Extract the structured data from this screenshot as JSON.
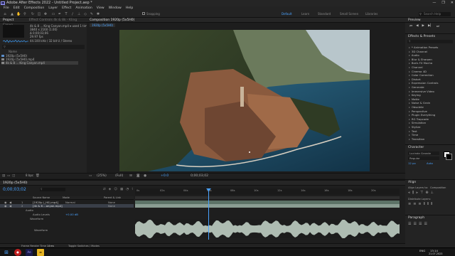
{
  "window": {
    "title": "Adobe After Effects 2022 - Untitled Project.aep *",
    "controls": [
      "—",
      "❐",
      "✕"
    ]
  },
  "menu": [
    "File",
    "Edit",
    "Composition",
    "Layer",
    "Effect",
    "Animation",
    "View",
    "Window",
    "Help"
  ],
  "toolbar": {
    "snapping": "Snapping",
    "workspaces": [
      "Default",
      "Learn",
      "Standard",
      "Small Screen",
      "Libraries"
    ],
    "active_workspace": "Default",
    "search_placeholder": "Search Help"
  },
  "project": {
    "tab": "Project",
    "effect_controls_tab": "Effect Controls 4k & 8k - Kling Canyo",
    "selected_name": "4k & 8 ... King Canyon.mp4 ▾ used 1 time",
    "selected_dims": "3840 x 2160 (1.00)",
    "selected_duration": "Δ 0;00;03;06",
    "selected_fps": "29.97 fps",
    "audio_info": "44.100 kHz / 32 bit U / Stereo",
    "col_name": "Name",
    "items": [
      "1920p (5x5H0)",
      "1920p (5x5H0).mp4",
      "4k & 8 ... King Canyon.mp4"
    ],
    "bpc": "8 bpc"
  },
  "composition": {
    "tab": "Composition  1920p (5x5H0)",
    "sub_tab": "1920p (5x5H0)",
    "zoom": "(25%)",
    "quality": "(Full)",
    "timecode": "0;00;03;02",
    "exposure": "+0.0"
  },
  "preview": {
    "title": "Preview"
  },
  "effects": {
    "title": "Effects & Presets",
    "search_placeholder": "",
    "items": [
      "* Animation Presets",
      "3D Channel",
      "Audio",
      "Blur & Sharpen",
      "Boris FX Mocha",
      "Channel",
      "Cinema 4D",
      "Color Correction",
      "Distort",
      "Expression Controls",
      "Generate",
      "Immersive Video",
      "Keying",
      "Matte",
      "Noise & Grain",
      "Obsolete",
      "Perspective",
      "Plugin Everything",
      "RG Trapcode",
      "Simulation",
      "Stylize",
      "Text",
      "Time",
      "Transition"
    ]
  },
  "character": {
    "title": "Character",
    "font": "Lucinda Grande",
    "style": "Regular",
    "size": "12 px",
    "leading": "Auto",
    "tracking": "0"
  },
  "align": {
    "title": "Align",
    "align_to": "Align Layers to:",
    "align_target": "Composition",
    "distribute": "Distribute Layers:"
  },
  "paragraph": {
    "title": "Paragraph"
  },
  "timeline": {
    "tab": "1920p (5x5H0)",
    "render_queue": "Render Queue",
    "timecode": "0;00;03;02",
    "col_source": "Source Name",
    "col_mode": "Mode",
    "col_parent": "Parent & Link",
    "layers": [
      {
        "num": "1",
        "name": "[1920p (_H0).mp4]",
        "mode": "Normal",
        "parent": "None"
      },
      {
        "num": "2",
        "name": "[4k & 8 ...anyon.mp4]",
        "mode": "",
        "parent": "None"
      }
    ],
    "audio_group": "Audio",
    "audio_levels_label": "Audio Levels",
    "audio_levels_value": "+0.00 dB",
    "waveform_label": "Waveform",
    "waveform_sub": "Waveform",
    "ruler": [
      "0s",
      "02s",
      "04s",
      "06s",
      "08s",
      "10s",
      "12s",
      "14s",
      "16s",
      "18s",
      "20s"
    ],
    "footer_left": "Frame Render Time",
    "footer_value": "14ms",
    "footer_mid": "Toggle Switches / Modes"
  },
  "taskbar": {
    "clock": "13:14",
    "date": "21.07.2023",
    "lang": "ENG"
  }
}
